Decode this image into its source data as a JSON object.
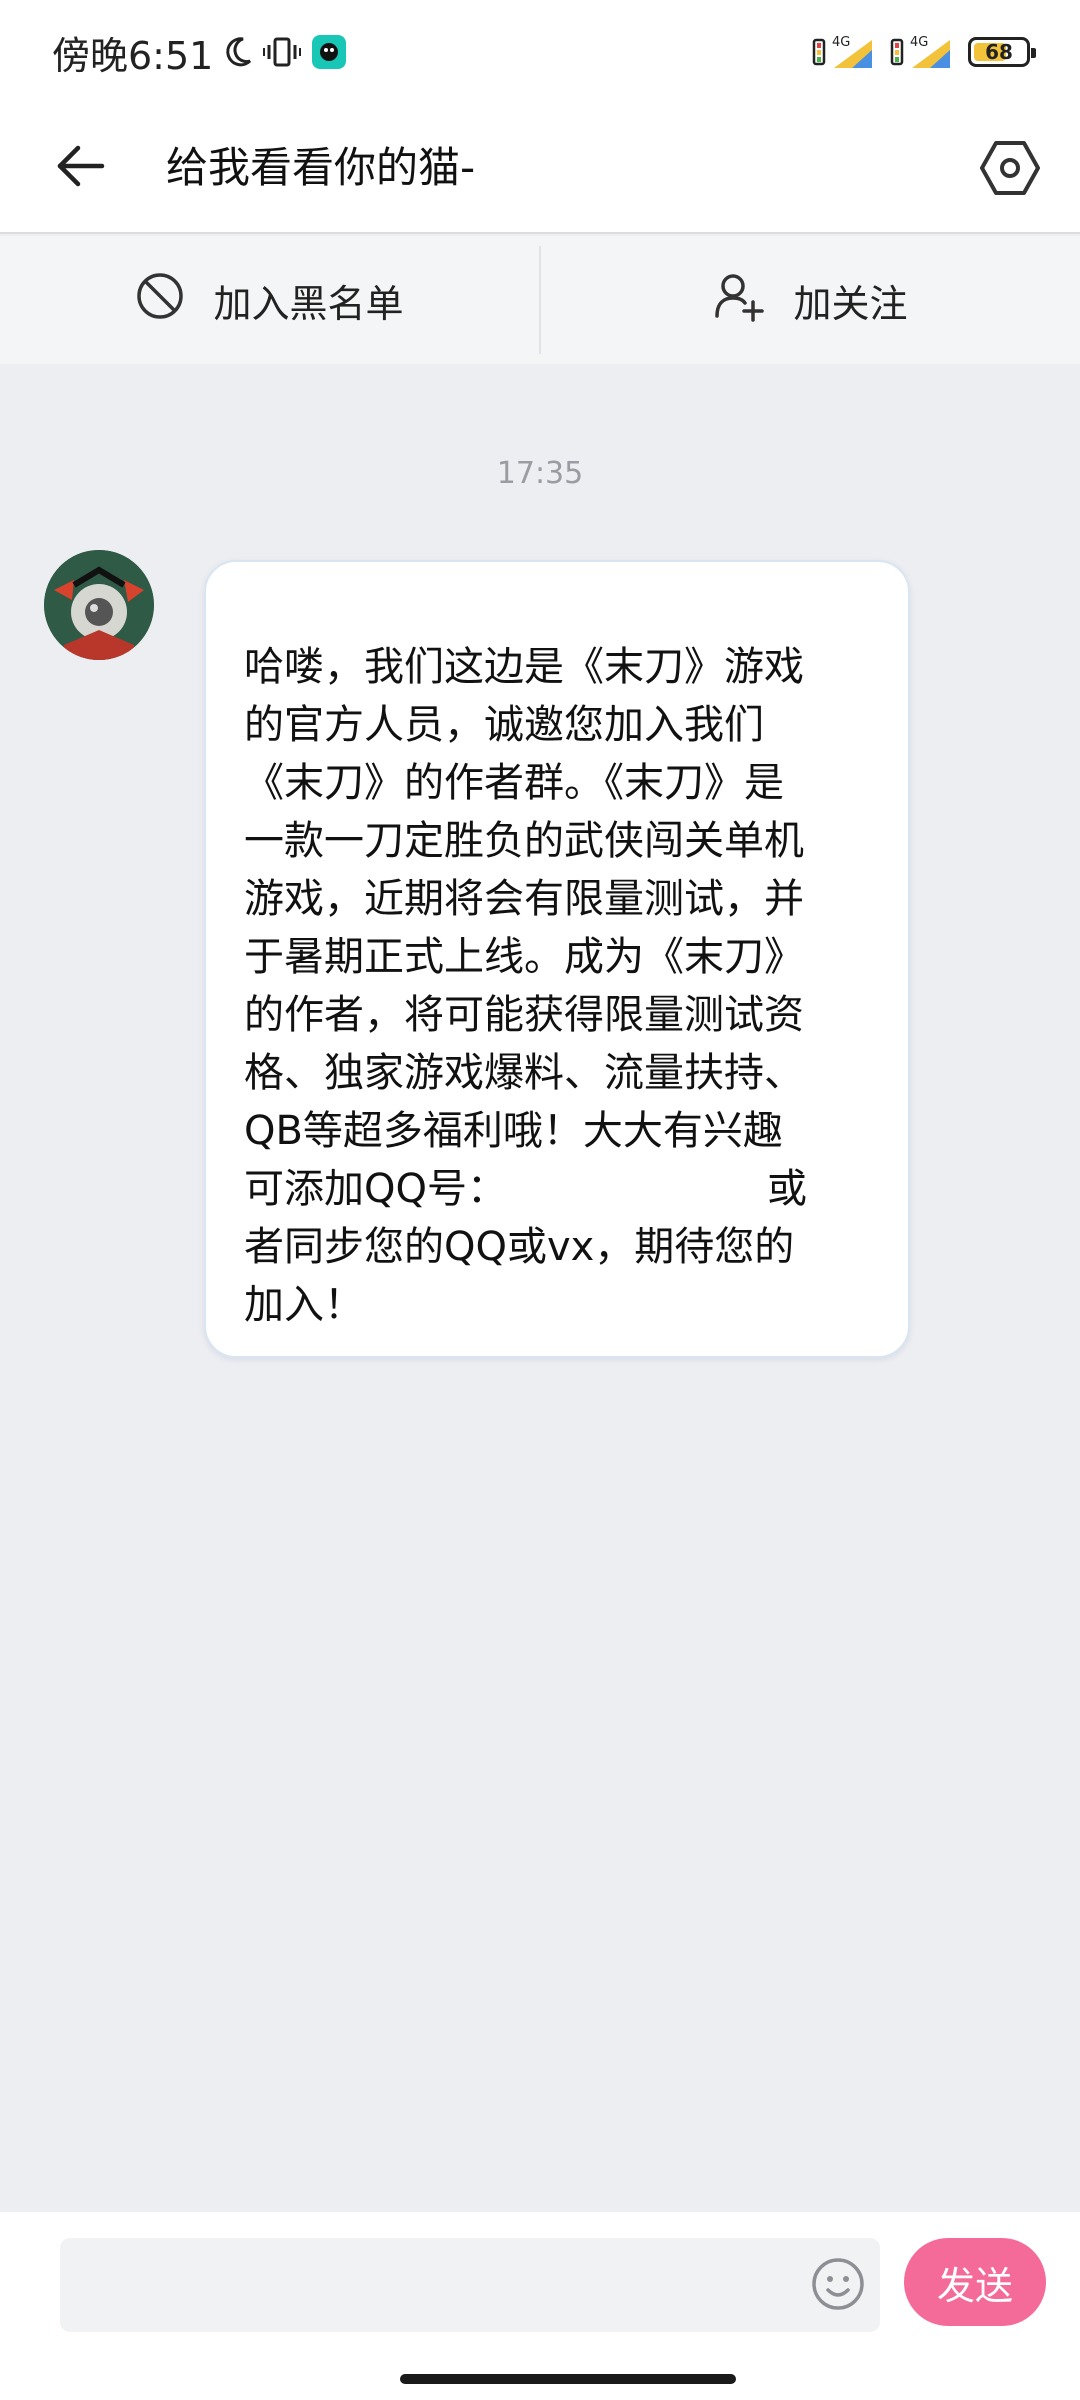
{
  "status_bar": {
    "time": "傍晚6:51",
    "network_1": "4G",
    "network_2": "4G",
    "battery": "68",
    "battery_level": 0.68,
    "icons": [
      "moon-icon",
      "vibrate-icon",
      "app-notification-icon",
      "signal-icon",
      "signal-icon",
      "battery-icon"
    ]
  },
  "header": {
    "title": "给我看看你的猫-",
    "back_icon": "arrow-left-icon",
    "settings_icon": "hexagon-settings-icon"
  },
  "actions": {
    "block_label": "加入黑名单",
    "follow_label": "加关注"
  },
  "chat": {
    "timestamp": "17:35",
    "messages": [
      {
        "from": "other",
        "text": "哈喽，我们这边是《末刀》游戏\n的官方人员，诚邀您加入我们\n《末刀》的作者群。《末刀》是\n一款一刀定胜负的武侠闯关单机\n游戏，近期将会有限量测试，并\n于暑期正式上线。成为《末刀》\n的作者，将可能获得限量测试资\n格、独家游戏爆料、流量扶持、\nQB等超多福利哦！大大有兴趣\n可添加QQ号：　　　　　　　或\n者同步您的QQ或vx，期待您的\n加入！"
      }
    ]
  },
  "input": {
    "placeholder": "",
    "send_label": "发送"
  },
  "colors": {
    "accent": "#f46a98",
    "background": "#edeef2"
  }
}
